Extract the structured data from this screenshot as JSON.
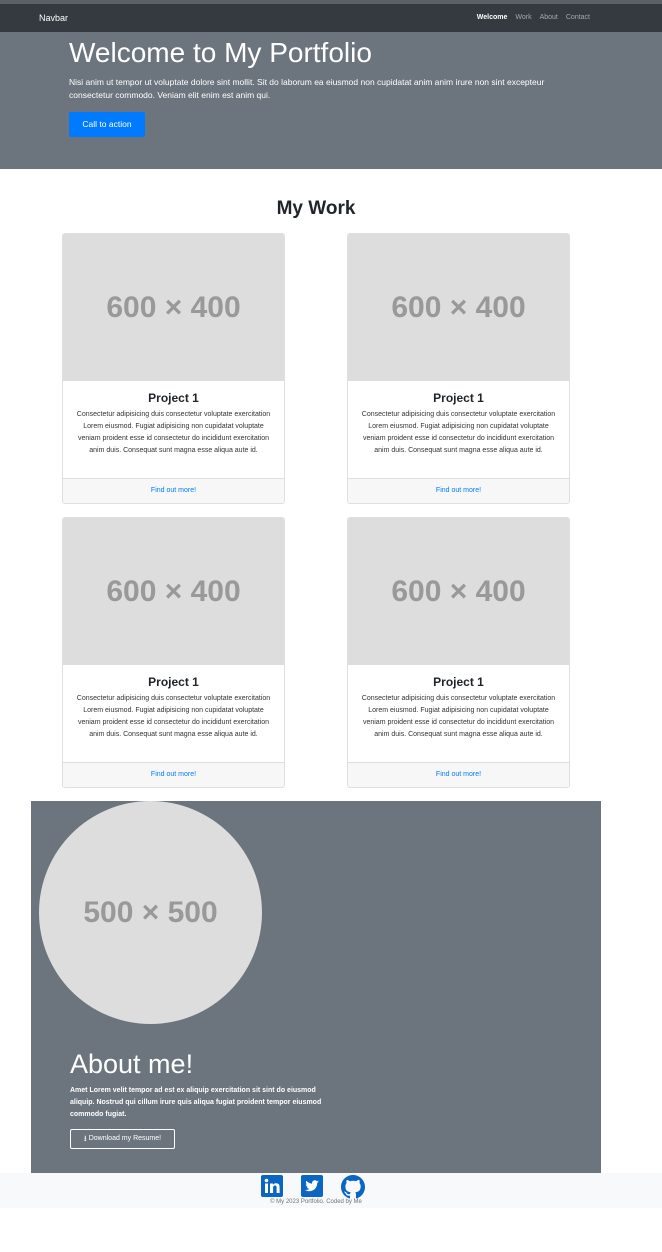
{
  "navbar": {
    "brand": "Navbar",
    "links": [
      "Welcome",
      "Work",
      "About",
      "Contact"
    ]
  },
  "hero": {
    "title": "Welcome to My Portfolio",
    "text": "Nisi anim ut tempor ut voluptate dolore sint mollit. Sit do laborum ea eiusmod non cupidatat anim anim irure non sint excepteur consectetur commodo. Veniam elit enim est anim qui.",
    "cta_label": "Call to action"
  },
  "work": {
    "title": "My Work",
    "cards": [
      {
        "image_label": "600 × 400",
        "title": "Project 1",
        "text": "Consectetur adipisicing duis consectetur voluptate exercitation Lorem eiusmod. Fugiat adipisicing non cupidatat voluptate veniam proident esse id consectetur do incididunt exercitation anim duis. Consequat sunt magna esse aliqua aute id.",
        "link_label": "Find out more!"
      },
      {
        "image_label": "600 × 400",
        "title": "Project 1",
        "text": "Consectetur adipisicing duis consectetur voluptate exercitation Lorem eiusmod. Fugiat adipisicing non cupidatat voluptate veniam proident esse id consectetur do incididunt exercitation anim duis. Consequat sunt magna esse aliqua aute id.",
        "link_label": "Find out more!"
      },
      {
        "image_label": "600 × 400",
        "title": "Project 1",
        "text": "Consectetur adipisicing duis consectetur voluptate exercitation Lorem eiusmod. Fugiat adipisicing non cupidatat voluptate veniam proident esse id consectetur do incididunt exercitation anim duis. Consequat sunt magna esse aliqua aute id.",
        "link_label": "Find out more!"
      },
      {
        "image_label": "600 × 400",
        "title": "Project 1",
        "text": "Consectetur adipisicing duis consectetur voluptate exercitation Lorem eiusmod. Fugiat adipisicing non cupidatat voluptate veniam proident esse id consectetur do incididunt exercitation anim duis. Consequat sunt magna esse aliqua aute id.",
        "link_label": "Find out more!"
      }
    ]
  },
  "about": {
    "image_label": "500 × 500",
    "title": "About me!",
    "text": "Amet Lorem velit tempor ad est ex aliquip exercitation sit sint do eiusmod aliquip. Nostrud qui cillum irure quis aliqua fugiat proident tempor eiusmod commodo fugiat.",
    "resume_label": "Download my Resume!"
  },
  "footer": {
    "icons": [
      "linkedin-icon",
      "twitter-icon",
      "github-icon"
    ],
    "copyright": "© My 2023 Portfolio. Coded by Me"
  },
  "colors": {
    "navbar_bg": "#343a40",
    "hero_bg": "#6c757d",
    "primary": "#007bff",
    "placeholder_bg": "#dddddd",
    "footer_bg": "#f8f9fa"
  }
}
